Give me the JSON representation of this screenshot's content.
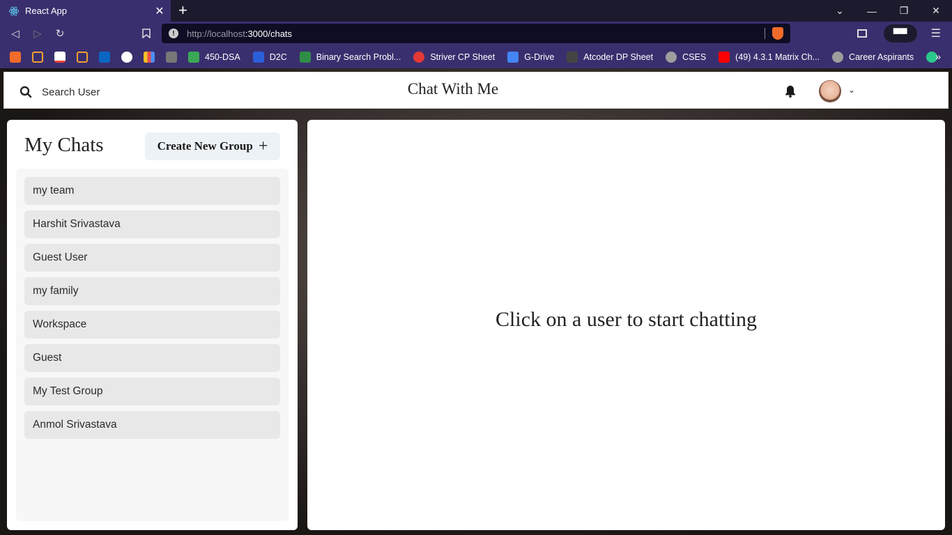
{
  "browser": {
    "tab_title": "React App",
    "tab_close": "✕",
    "new_tab": "+",
    "url_host": "http://localhost",
    "url_rest": ":3000/chats",
    "window_controls": [
      "⌄",
      "—",
      "❐",
      "✕"
    ],
    "bookmarks": [
      {
        "label": "450-DSA",
        "color": "#3aa757"
      },
      {
        "label": "D2C",
        "color": "#2b5fd9"
      },
      {
        "label": "Binary Search Probl...",
        "color": "#2f8d46"
      },
      {
        "label": "Striver CP Sheet",
        "color": "#e53935"
      },
      {
        "label": "G-Drive",
        "color": "#4285f4"
      },
      {
        "label": "Atcoder DP Sheet",
        "color": "#444444"
      },
      {
        "label": "CSES",
        "color": "#9e9e9e"
      },
      {
        "label": "(49) 4.3.1 Matrix Ch...",
        "color": "#ff0000"
      },
      {
        "label": "Career Aspirants",
        "color": "#9e9e9e"
      }
    ],
    "bookmarks_more": "»"
  },
  "header": {
    "search_label": "Search User",
    "app_title": "Chat With Me"
  },
  "chats": {
    "title": "My Chats",
    "create_group_label": "Create New Group",
    "create_group_icon": "+",
    "items": [
      "my team",
      "Harshit Srivastava",
      "Guest User",
      "my family",
      "Workspace",
      "Guest",
      "My Test Group",
      "Anmol Srivastava"
    ]
  },
  "chat_box": {
    "empty_message": "Click on a user to start chatting"
  }
}
